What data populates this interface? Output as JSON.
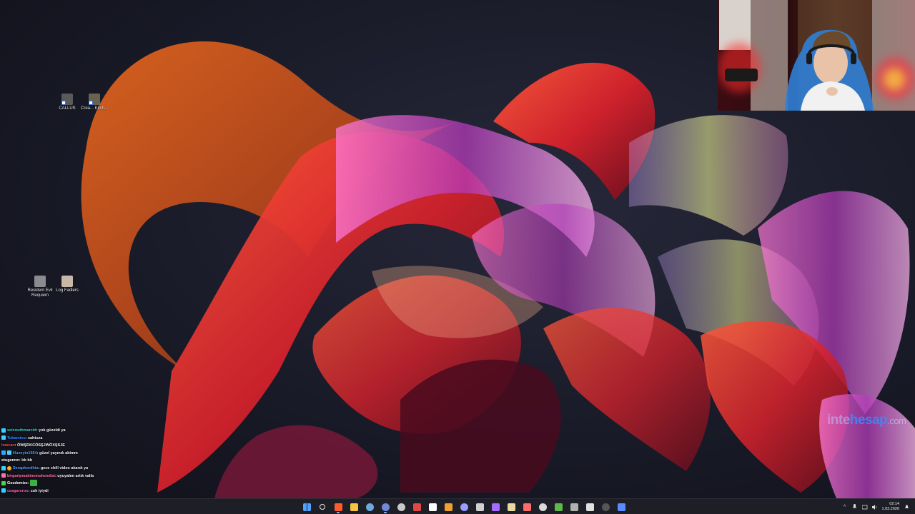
{
  "desktop_icons": [
    {
      "label": "CALLUS",
      "kind": "game-shortcut"
    },
    {
      "label": "Crea... Kitch...",
      "kind": "game-shortcut"
    },
    {
      "label": "Resident Evil Requiem",
      "kind": "game-shortcut"
    },
    {
      "label": "Log Fadlers",
      "kind": "game-shortcut"
    }
  ],
  "watermark": {
    "part1": "inte",
    "part2": "hesap",
    "part3": ".com"
  },
  "chat": [
    {
      "user": "selcouthmarcid",
      "message": ": çok güzeldi ya",
      "color": "#2fd3c8"
    },
    {
      "user": "Tubamisu",
      "message": ": sahtuza",
      "color": "#2f8cff"
    },
    {
      "user": "lowcan",
      "message": ": ÖWŞDKCÖSŞJWÖXŞSJE",
      "color": "#ff4a4a"
    },
    {
      "user": "Huseyin1554",
      "message": ": güzel yayındı abimm",
      "color": "#3fa0ff"
    },
    {
      "user": "etugennn",
      "message": ": bb bb",
      "color": "#ffffff"
    },
    {
      "user": "Seraphordhia",
      "message": ": gece chill video akardı ya",
      "color": "#4aa0ff"
    },
    {
      "user": "birgaripmakinemuhendisi",
      "message": ": uyuyalım artık valla",
      "color": "#ff6fa8"
    },
    {
      "user": "Gozdemizz",
      "message": ":",
      "color": "#ffffff"
    },
    {
      "user": "ceagarcros",
      "message": ": cok iyiydi",
      "color": "#ff5fb0"
    }
  ],
  "taskbar": {
    "icons": [
      {
        "name": "start-icon",
        "color": "#4da3ff"
      },
      {
        "name": "search-icon",
        "color": "#e6e6e6"
      },
      {
        "name": "brave-icon",
        "color": "#ff5a2c",
        "active": true
      },
      {
        "name": "file-explorer-icon",
        "color": "#f5c542"
      },
      {
        "name": "steam-icon",
        "color": "#6fa8dc"
      },
      {
        "name": "discord-icon",
        "color": "#7289da",
        "active": true
      },
      {
        "name": "obs-icon",
        "color": "#c9c9c9"
      },
      {
        "name": "app-red-icon",
        "color": "#e04848"
      },
      {
        "name": "epic-games-icon",
        "color": "#ffffff"
      },
      {
        "name": "affinity-icon",
        "color": "#f0a030"
      },
      {
        "name": "app-circle-icon",
        "color": "#9a9cff"
      },
      {
        "name": "app-clock-icon",
        "color": "#d0d0d0"
      },
      {
        "name": "app-purple-icon",
        "color": "#a76cff"
      },
      {
        "name": "app-feather-icon",
        "color": "#e8d9a0"
      },
      {
        "name": "app-calendar-icon",
        "color": "#ff6a6a"
      },
      {
        "name": "chatgpt-icon",
        "color": "#d9d9d9"
      },
      {
        "name": "minecraft-icon",
        "color": "#5fb84a"
      },
      {
        "name": "app-stack-icon",
        "color": "#b0b0b0"
      },
      {
        "name": "app-ghost-icon",
        "color": "#e0e0e0"
      },
      {
        "name": "app-dark-circle-icon",
        "color": "#555555"
      },
      {
        "name": "app-blue-gear-icon",
        "color": "#5a8aff"
      }
    ],
    "tray_chevron": "^",
    "clock_time": "02:14",
    "clock_date": "1.03.2026"
  }
}
